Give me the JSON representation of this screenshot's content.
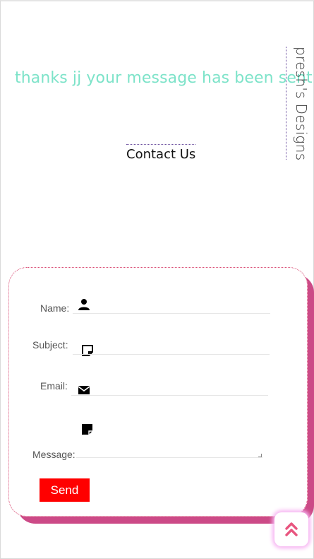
{
  "success_message": "thanks jj your message has been sent",
  "brand": "presh's Designs",
  "contact_title": "Contact Us",
  "form": {
    "name_label": "Name:",
    "subject_label": "Subject:",
    "email_label": "Email:",
    "message_label": "Message:",
    "name_value": "",
    "subject_value": "",
    "email_value": "",
    "message_value": "",
    "send_label": "Send"
  },
  "icons": {
    "name": "person-icon",
    "subject": "note-icon",
    "email": "envelope-icon",
    "message": "note-icon",
    "scroll_top": "double-chevron-up-icon"
  },
  "colors": {
    "success": "#7de3c9",
    "card_shadow": "#cc4a87",
    "send_button": "#ff0000",
    "scroll_top_glow": "#f7b4f2",
    "scroll_top_icon": "#e8557f"
  }
}
